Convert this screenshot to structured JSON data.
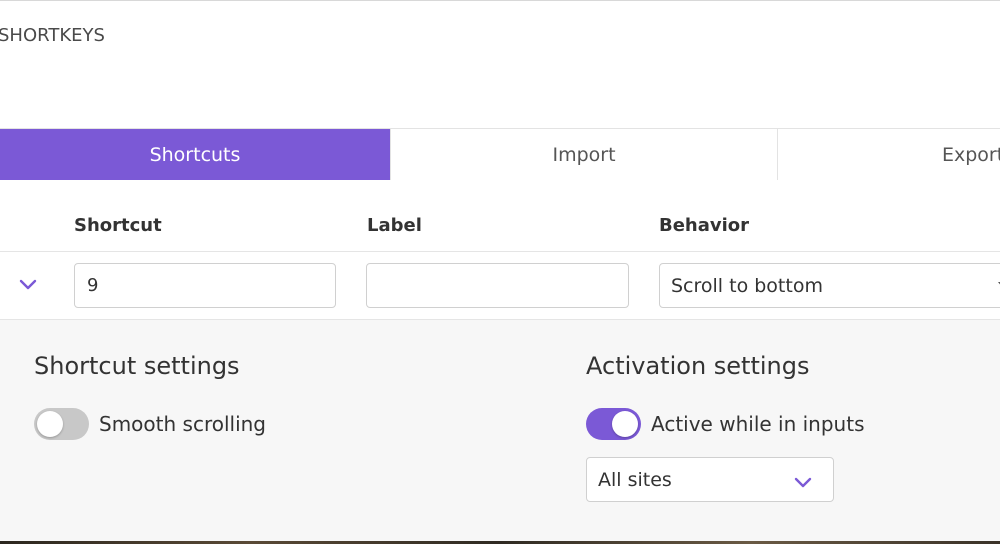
{
  "app": {
    "title": "SHORTKEYS"
  },
  "tabs": [
    {
      "label": "Shortcuts",
      "active": true
    },
    {
      "label": "Import",
      "active": false
    },
    {
      "label": "Export",
      "active": false
    }
  ],
  "table": {
    "headers": {
      "shortcut": "Shortcut",
      "label": "Label",
      "behavior": "Behavior"
    },
    "row": {
      "shortcut_value": "9",
      "label_value": "",
      "behavior_value": "Scroll to bottom",
      "expanded": true
    }
  },
  "shortcut_settings": {
    "title": "Shortcut settings",
    "smooth_scrolling": {
      "label": "Smooth scrolling",
      "enabled": false
    }
  },
  "activation_settings": {
    "title": "Activation settings",
    "active_in_inputs": {
      "label": "Active while in inputs",
      "enabled": true
    },
    "sites_select": {
      "value": "All sites"
    }
  },
  "colors": {
    "accent": "#7b59d6",
    "toggle_off": "#c8c8c8",
    "panel_background": "#f7f7f7"
  },
  "icons": {
    "row_toggle": "chevron-down-icon",
    "behavior_dropdown": "caret-down-icon",
    "sites_dropdown": "chevron-down-icon"
  }
}
